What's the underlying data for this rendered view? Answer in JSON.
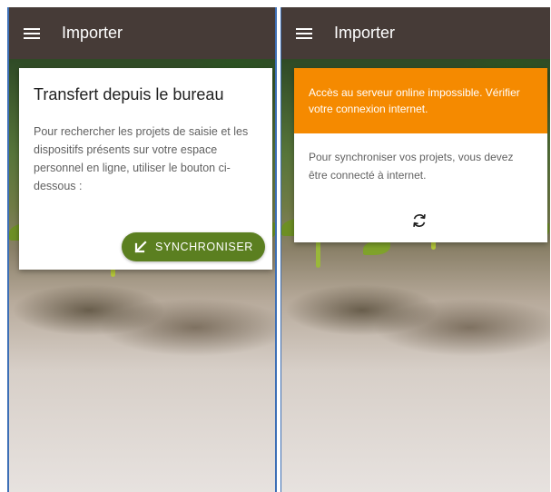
{
  "screens": [
    {
      "appbar": {
        "title": "Importer",
        "menu_icon": "hamburger-menu-icon"
      },
      "card": {
        "title": "Transfert depuis le bureau",
        "text": "Pour rechercher les projets de saisie et les dispositifs présents sur votre espace personnel en ligne, utiliser le bouton ci-dessous :",
        "button": {
          "label": "SYNCHRONISER",
          "icon": "arrow-down-left-icon"
        }
      }
    },
    {
      "appbar": {
        "title": "Importer",
        "menu_icon": "hamburger-menu-icon"
      },
      "error": {
        "text": "Accès au serveur online impossible. Vérifier votre connexion internet."
      },
      "card": {
        "text": "Pour synchroniser vos projets, vous devez être connecté à internet.",
        "action_icon": "refresh-icon"
      }
    }
  ],
  "colors": {
    "appbar": "#463b37",
    "button": "#5b7f20",
    "error_banner": "#f58a00",
    "divider_border": "#3d6fb6"
  }
}
